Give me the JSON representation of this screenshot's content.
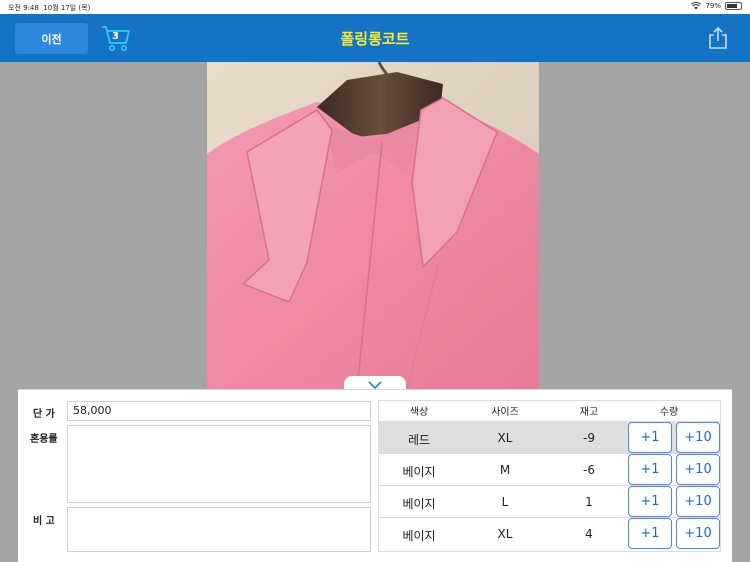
{
  "status_bar": {
    "time": "오전 9:48",
    "date": "10월 17일 (목)",
    "battery": "79%",
    "battery_level": 0.79
  },
  "nav": {
    "back_label": "이전",
    "cart_count": "3",
    "title": "폴링롱코트"
  },
  "colors": {
    "nav_bg": "#1573c5",
    "title": "#f4ea3a",
    "button_accent": "#1b6bd1"
  },
  "form": {
    "price_label": "단 가",
    "price_value": "58,000",
    "blend_label": "혼용률",
    "note_label": "비 고"
  },
  "table": {
    "headers": {
      "color": "색상",
      "size": "사이즈",
      "stock": "재고",
      "qty": "수량"
    },
    "rows": [
      {
        "color": "레드",
        "size": "XL",
        "stock": "-9",
        "plus1": "+1",
        "plus10": "+10",
        "selected": true
      },
      {
        "color": "베이지",
        "size": "M",
        "stock": "-6",
        "plus1": "+1",
        "plus10": "+10",
        "selected": false
      },
      {
        "color": "베이지",
        "size": "L",
        "stock": "1",
        "plus1": "+1",
        "plus10": "+10",
        "selected": false
      },
      {
        "color": "베이지",
        "size": "XL",
        "stock": "4",
        "plus1": "+1",
        "plus10": "+10",
        "selected": false
      }
    ]
  },
  "icons": [
    "cart-icon",
    "share-icon",
    "chevron-down-icon",
    "wifi-icon",
    "battery-icon"
  ]
}
